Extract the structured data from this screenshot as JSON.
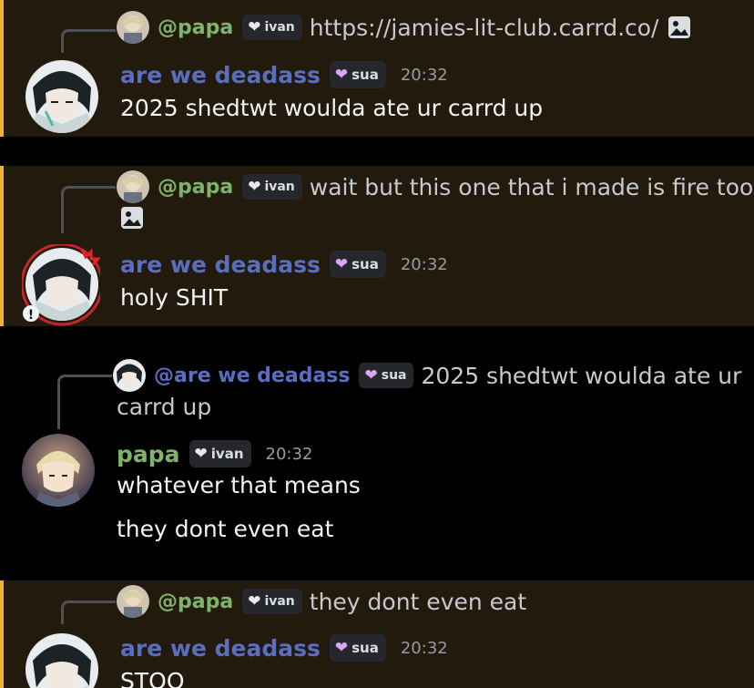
{
  "colors": {
    "highlight_bg": "#221b0d",
    "highlight_bar": "#f0b232",
    "name_deadass": "#5b6dbf",
    "name_papa": "#7fb26b",
    "text": "#f2f3f5",
    "muted": "#949ba4"
  },
  "messages": [
    {
      "reply": {
        "name": "@papa",
        "tag": "ivan",
        "text": "https://jamies-lit-club.carrd.co/",
        "icon": "image-icon"
      },
      "author": "are we deadass",
      "tag": "sua",
      "time": "20:32",
      "lines": [
        "2025 shedtwt woulda ate ur carrd up"
      ],
      "highlighted": true
    },
    {
      "reply": {
        "name": "@papa",
        "tag": "ivan",
        "text": "wait but this one that i made is fire too",
        "icon": "image-icon"
      },
      "author": "are we deadass",
      "tag": "sua",
      "time": "20:32",
      "lines": [
        "holy SHIT"
      ],
      "highlighted": true
    },
    {
      "reply": {
        "name": "@are we deadass",
        "tag": "sua",
        "text": "2025 shedtwt woulda ate ur",
        "text_cont": "carrd up"
      },
      "author": "papa",
      "tag": "ivan",
      "time": "20:32",
      "lines": [
        "whatever that means",
        "they dont even eat"
      ],
      "highlighted": false
    },
    {
      "reply": {
        "name": "@papa",
        "tag": "ivan",
        "text": "they dont even eat"
      },
      "author": "are we deadass",
      "tag": "sua",
      "time": "20:32",
      "lines": [
        "STOO"
      ],
      "highlighted": true
    }
  ]
}
